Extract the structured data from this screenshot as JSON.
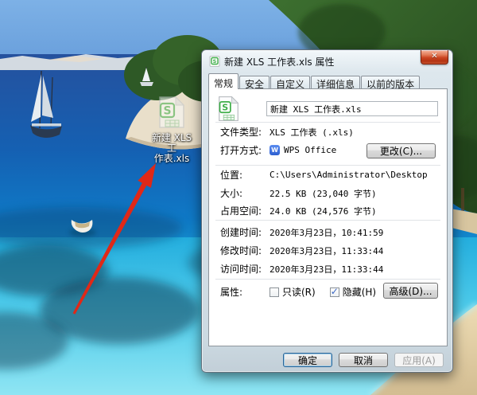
{
  "icons": {
    "close_x": "✕",
    "wps_w": "W",
    "sheet_s": "S"
  },
  "colors": {
    "arrow_red": "#e02817",
    "close_button_red": "#cc4522",
    "wps_blue": "#2d5fd0",
    "file_icon_green": "#3fae49",
    "ok_focus_blue": "#9ecbe8",
    "sea_deep": "#1a55a8",
    "sea_turquoise": "#3cc3e8",
    "sand": "#e3d0a8"
  },
  "desktop": {
    "icon": {
      "label_line1": "新建 XLS 工",
      "label_line2": "作表.xls",
      "full_name": "新建 XLS 工作表.xls"
    }
  },
  "dialog": {
    "title": "新建 XLS 工作表.xls 属性",
    "tabs": [
      {
        "label": "常规",
        "active": true
      },
      {
        "label": "安全",
        "active": false
      },
      {
        "label": "自定义",
        "active": false
      },
      {
        "label": "详细信息",
        "active": false
      },
      {
        "label": "以前的版本",
        "active": false
      }
    ],
    "general": {
      "filename": "新建 XLS 工作表.xls",
      "rows": {
        "file_type": {
          "label": "文件类型:",
          "value": "XLS 工作表 (.xls)"
        },
        "open_with": {
          "label": "打开方式:",
          "value": "WPS Office",
          "change_button": "更改(C)..."
        },
        "location": {
          "label": "位置:",
          "value": "C:\\Users\\Administrator\\Desktop"
        },
        "size": {
          "label": "大小:",
          "value": "22.5 KB (23,040 字节)"
        },
        "size_on_disk": {
          "label": "占用空间:",
          "value": "24.0 KB (24,576 字节)"
        },
        "created": {
          "label": "创建时间:",
          "value": "2020年3月23日，10:41:59"
        },
        "modified": {
          "label": "修改时间:",
          "value": "2020年3月23日，11:33:44"
        },
        "accessed": {
          "label": "访问时间:",
          "value": "2020年3月23日，11:33:44"
        }
      },
      "attributes": {
        "label": "属性:",
        "readonly_label": "只读(R)",
        "readonly_checked": false,
        "hidden_label": "隐藏(H)",
        "hidden_checked": true,
        "advanced_button": "高级(D)..."
      }
    },
    "footer": {
      "ok": "确定",
      "cancel": "取消",
      "apply": "应用(A)",
      "apply_enabled": false
    }
  }
}
